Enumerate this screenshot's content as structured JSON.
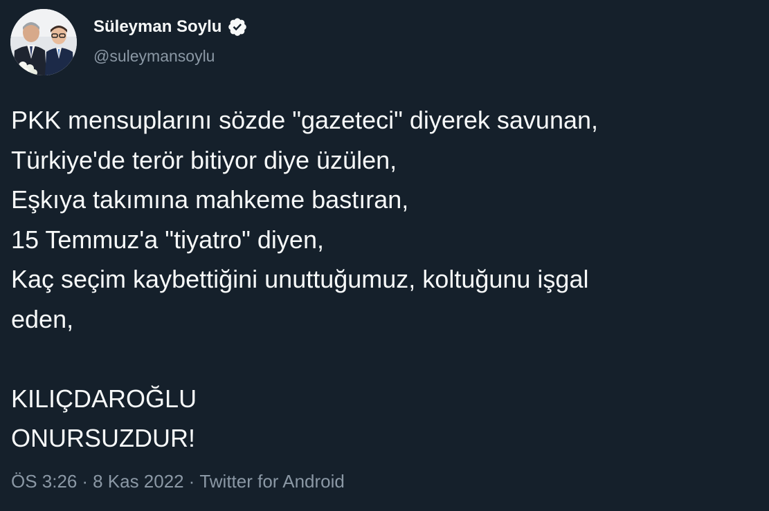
{
  "author": {
    "display_name": "Süleyman Soylu",
    "handle": "@suleymansoylu",
    "verified_icon": "verified-badge-icon",
    "avatar": "profile-photo"
  },
  "tweet": {
    "lines": [
      "PKK mensuplarını sözde \"gazeteci\" diyerek savunan,",
      "Türkiye'de terör bitiyor diye üzülen,",
      "Eşkıya takımına mahkeme bastıran,",
      "15 Temmuz'a \"tiyatro\" diyen,",
      "Kaç seçim kaybettiğini unuttuğumuz, koltuğunu işgal",
      "eden,",
      "",
      "KILIÇDAROĞLU",
      "ONURSUZDUR!"
    ]
  },
  "meta": {
    "time": "ÖS 3:26",
    "date": "8 Kas 2022",
    "source": "Twitter for Android",
    "separator": "·"
  },
  "colors": {
    "background": "#15202b",
    "text": "#f7f9f9",
    "secondary": "#8b98a5"
  }
}
